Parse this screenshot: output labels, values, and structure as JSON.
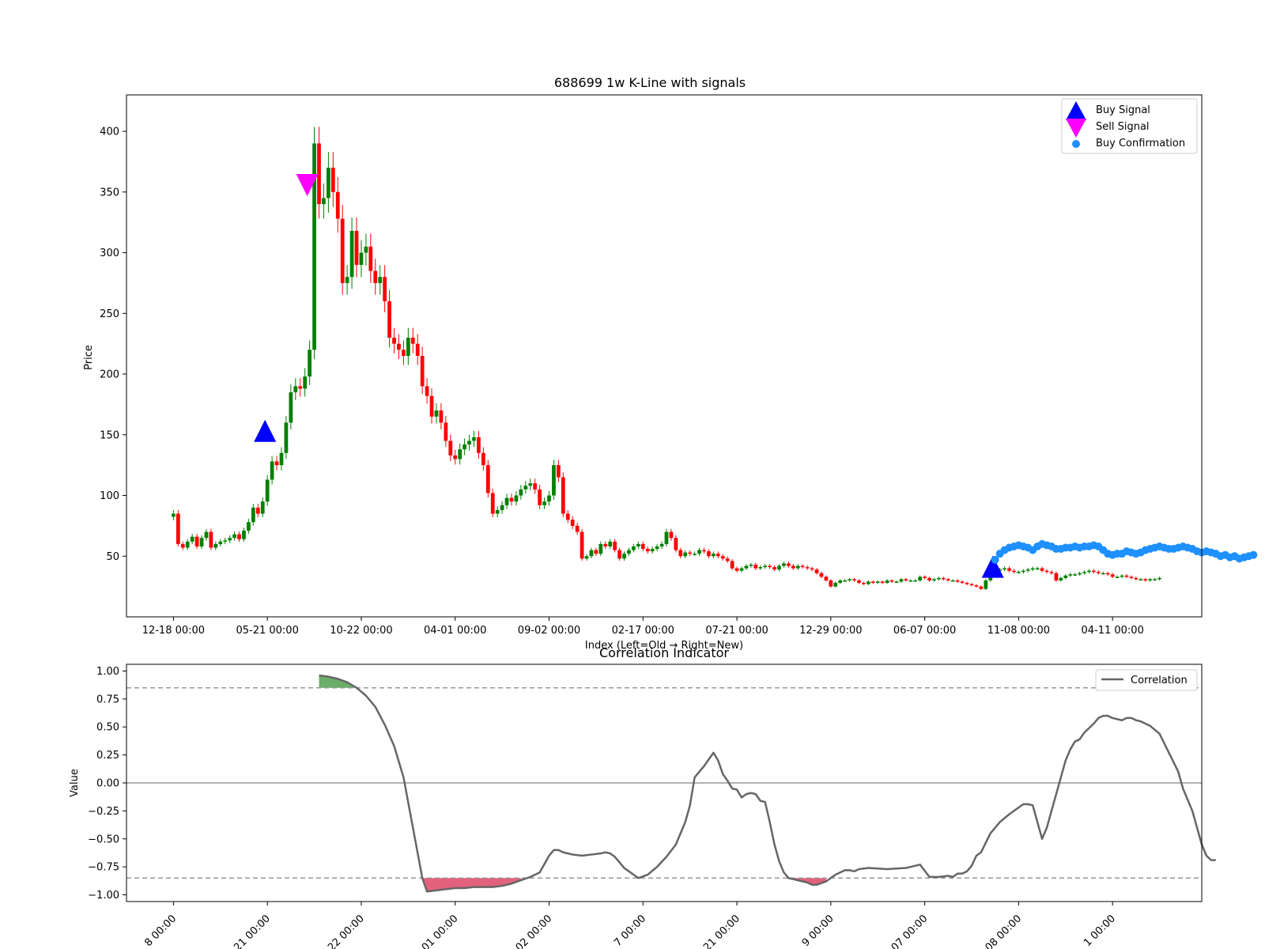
{
  "chart_data": [
    {
      "type": "candlestick",
      "title": "688699 1w K-Line with signals",
      "xlabel": "Index (Left=Old → Right=New)",
      "ylabel": "Price",
      "ylim": [
        0,
        430
      ],
      "yticks": [
        50,
        100,
        150,
        200,
        250,
        300,
        350,
        400
      ],
      "xticks": [
        {
          "i": 0,
          "label": "12-18 00:00"
        },
        {
          "i": 20,
          "label": "05-21 00:00"
        },
        {
          "i": 40,
          "label": "10-22 00:00"
        },
        {
          "i": 60,
          "label": "04-01 00:00"
        },
        {
          "i": 80,
          "label": "09-02 00:00"
        },
        {
          "i": 100,
          "label": "02-17 00:00"
        },
        {
          "i": 120,
          "label": "07-21 00:00"
        },
        {
          "i": 140,
          "label": "12-29 00:00"
        },
        {
          "i": 160,
          "label": "06-07 00:00"
        },
        {
          "i": 180,
          "label": "11-08 00:00"
        },
        {
          "i": 200,
          "label": "04-11 00:00"
        }
      ],
      "xlim": [
        -10,
        219
      ],
      "closes": [
        85,
        60,
        57,
        62,
        66,
        58,
        65,
        70,
        57,
        60,
        62,
        63,
        65,
        68,
        64,
        71,
        78,
        90,
        85,
        95,
        113,
        128,
        125,
        135,
        160,
        185,
        190,
        188,
        198,
        220,
        390,
        340,
        345,
        370,
        350,
        328,
        275,
        280,
        318,
        290,
        300,
        305,
        285,
        275,
        280,
        260,
        230,
        225,
        220,
        215,
        230,
        225,
        215,
        190,
        182,
        165,
        170,
        160,
        145,
        133,
        130,
        138,
        142,
        145,
        148,
        135,
        125,
        102,
        85,
        88,
        92,
        98,
        95,
        100,
        105,
        108,
        110,
        105,
        92,
        95,
        100,
        125,
        115,
        85,
        80,
        75,
        70,
        48,
        50,
        55,
        52,
        60,
        58,
        62,
        55,
        48,
        52,
        55,
        58,
        60,
        56,
        54,
        56,
        58,
        60,
        70,
        65,
        55,
        50,
        53,
        52,
        52,
        55,
        54,
        50,
        52,
        50,
        48,
        46,
        40,
        38,
        40,
        42,
        43,
        40,
        41,
        42,
        41,
        39,
        42,
        44,
        42,
        40,
        42,
        41,
        40,
        39,
        36,
        33,
        30,
        25,
        28,
        30,
        30,
        31,
        30,
        28,
        27,
        29,
        28,
        29,
        28,
        30,
        29,
        29,
        31,
        30,
        30,
        30,
        33,
        32,
        30,
        31,
        32,
        31,
        30,
        30,
        29,
        28,
        27,
        26,
        25,
        23,
        30,
        38,
        38,
        39,
        40,
        38,
        37,
        37,
        38,
        39,
        40,
        40,
        38,
        37,
        36,
        30,
        32,
        34,
        35,
        35,
        36,
        37,
        38,
        37,
        36,
        36,
        35,
        33,
        33,
        34,
        33,
        32,
        31,
        31,
        30,
        31,
        31,
        32
      ],
      "signals": [
        {
          "type": "buy",
          "i": 19.5,
          "price": 152
        },
        {
          "type": "sell",
          "i": 28.5,
          "price": 357
        },
        {
          "type": "buy",
          "i": 174.5,
          "price": 40
        }
      ],
      "buy_confirmation": [
        47,
        52,
        55,
        57,
        58,
        59,
        58,
        57,
        55,
        58,
        60,
        59,
        58,
        56,
        56,
        57,
        57,
        58,
        57,
        58,
        58,
        59,
        58,
        55,
        52,
        51,
        52,
        52,
        54,
        53,
        52,
        53,
        55,
        56,
        57,
        58,
        57,
        56,
        56,
        57,
        58,
        57,
        56,
        54,
        53,
        54,
        53,
        52,
        50,
        51,
        49,
        50,
        48,
        49,
        50,
        51
      ],
      "buy_confirmation_start": 175,
      "legend": {
        "position": "upper right",
        "items": [
          "Buy Signal",
          "Sell Signal",
          "Buy Confirmation"
        ]
      },
      "colors": {
        "up": "#008000",
        "down": "#ff0000",
        "buy": "#0000ff",
        "sell": "#ff00ff",
        "confirm": "#1e90ff"
      }
    },
    {
      "type": "line",
      "title": "Correlation Indicator",
      "ylabel": "Value",
      "ylim": [
        -1.06,
        1.06
      ],
      "yticks": [
        1.0,
        0.75,
        0.5,
        0.25,
        0.0,
        -0.25,
        -0.5,
        -0.75,
        -1.0
      ],
      "ytick_labels": [
        "1.00",
        "0.75",
        "0.50",
        "0.25",
        "0.00",
        "−0.25",
        "−0.50",
        "−0.75",
        "−1.00"
      ],
      "thresholds": [
        0.85,
        -0.85
      ],
      "xtick_labels": [
        "8 00:00",
        "21 00:00",
        "22 00:00",
        "01 00:00",
        "02 00:00",
        "7 00:00",
        "21 00:00",
        "9 00:00",
        "07 00:00",
        "08 00:00",
        "1 00:00"
      ],
      "points": [
        [
          31,
          0.96
        ],
        [
          33,
          0.95
        ],
        [
          35,
          0.93
        ],
        [
          37,
          0.9
        ],
        [
          39,
          0.85
        ],
        [
          41,
          0.78
        ],
        [
          43,
          0.68
        ],
        [
          45,
          0.52
        ],
        [
          47,
          0.33
        ],
        [
          49,
          0.05
        ],
        [
          51,
          -0.4
        ],
        [
          53,
          -0.85
        ],
        [
          54,
          -0.97
        ],
        [
          56,
          -0.96
        ],
        [
          58,
          -0.95
        ],
        [
          60,
          -0.94
        ],
        [
          62,
          -0.94
        ],
        [
          64,
          -0.93
        ],
        [
          66,
          -0.93
        ],
        [
          68,
          -0.93
        ],
        [
          70,
          -0.92
        ],
        [
          72,
          -0.9
        ],
        [
          74,
          -0.87
        ],
        [
          76,
          -0.84
        ],
        [
          78,
          -0.8
        ],
        [
          80,
          -0.65
        ],
        [
          81,
          -0.6
        ],
        [
          82,
          -0.6
        ],
        [
          83,
          -0.62
        ],
        [
          85,
          -0.64
        ],
        [
          87,
          -0.65
        ],
        [
          89,
          -0.64
        ],
        [
          91,
          -0.63
        ],
        [
          92,
          -0.62
        ],
        [
          93,
          -0.63
        ],
        [
          94,
          -0.66
        ],
        [
          96,
          -0.76
        ],
        [
          98,
          -0.82
        ],
        [
          99,
          -0.85
        ],
        [
          101,
          -0.82
        ],
        [
          103,
          -0.75
        ],
        [
          105,
          -0.66
        ],
        [
          107,
          -0.55
        ],
        [
          109,
          -0.35
        ],
        [
          110,
          -0.2
        ],
        [
          111,
          0.05
        ],
        [
          112,
          0.1
        ],
        [
          113,
          0.15
        ],
        [
          115,
          0.27
        ],
        [
          116,
          0.2
        ],
        [
          117,
          0.08
        ],
        [
          118,
          0.02
        ],
        [
          119,
          -0.05
        ],
        [
          120,
          -0.06
        ],
        [
          121,
          -0.13
        ],
        [
          122,
          -0.1
        ],
        [
          123,
          -0.09
        ],
        [
          124,
          -0.1
        ],
        [
          125,
          -0.16
        ],
        [
          126,
          -0.17
        ],
        [
          127,
          -0.35
        ],
        [
          128,
          -0.55
        ],
        [
          129,
          -0.7
        ],
        [
          130,
          -0.8
        ],
        [
          131,
          -0.85
        ],
        [
          133,
          -0.87
        ],
        [
          135,
          -0.89
        ],
        [
          136,
          -0.91
        ],
        [
          137,
          -0.91
        ],
        [
          139,
          -0.88
        ],
        [
          141,
          -0.82
        ],
        [
          143,
          -0.78
        ],
        [
          144,
          -0.78
        ],
        [
          145,
          -0.79
        ],
        [
          146,
          -0.77
        ],
        [
          148,
          -0.76
        ],
        [
          152,
          -0.77
        ],
        [
          156,
          -0.76
        ],
        [
          159,
          -0.73
        ],
        [
          161,
          -0.84
        ],
        [
          163,
          -0.84
        ],
        [
          165,
          -0.83
        ],
        [
          166,
          -0.84
        ],
        [
          167,
          -0.81
        ],
        [
          168,
          -0.81
        ],
        [
          169,
          -0.79
        ],
        [
          170,
          -0.74
        ],
        [
          171,
          -0.65
        ],
        [
          172,
          -0.62
        ],
        [
          174,
          -0.45
        ],
        [
          176,
          -0.35
        ],
        [
          178,
          -0.28
        ],
        [
          180,
          -0.22
        ],
        [
          181,
          -0.19
        ],
        [
          182,
          -0.19
        ],
        [
          183,
          -0.2
        ],
        [
          184,
          -0.35
        ],
        [
          185,
          -0.5
        ],
        [
          186,
          -0.4
        ],
        [
          188,
          -0.1
        ],
        [
          190,
          0.2
        ],
        [
          191,
          0.3
        ],
        [
          192,
          0.37
        ],
        [
          193,
          0.39
        ],
        [
          194,
          0.45
        ],
        [
          196,
          0.53
        ],
        [
          197,
          0.58
        ],
        [
          198,
          0.6
        ],
        [
          199,
          0.6
        ],
        [
          200,
          0.58
        ],
        [
          202,
          0.56
        ],
        [
          203,
          0.58
        ],
        [
          204,
          0.58
        ],
        [
          205,
          0.56
        ],
        [
          206,
          0.55
        ],
        [
          208,
          0.51
        ],
        [
          210,
          0.44
        ],
        [
          212,
          0.27
        ],
        [
          214,
          0.1
        ],
        [
          215,
          -0.05
        ],
        [
          217,
          -0.25
        ],
        [
          219,
          -0.55
        ],
        [
          220,
          -0.65
        ],
        [
          221,
          -0.69
        ],
        [
          222,
          -0.69
        ]
      ],
      "legend": {
        "position": "upper right",
        "items": [
          "Correlation"
        ]
      },
      "colors": {
        "line": "#666666",
        "pos_fill": "#5aa55a",
        "neg_fill": "#e0506e"
      }
    }
  ]
}
